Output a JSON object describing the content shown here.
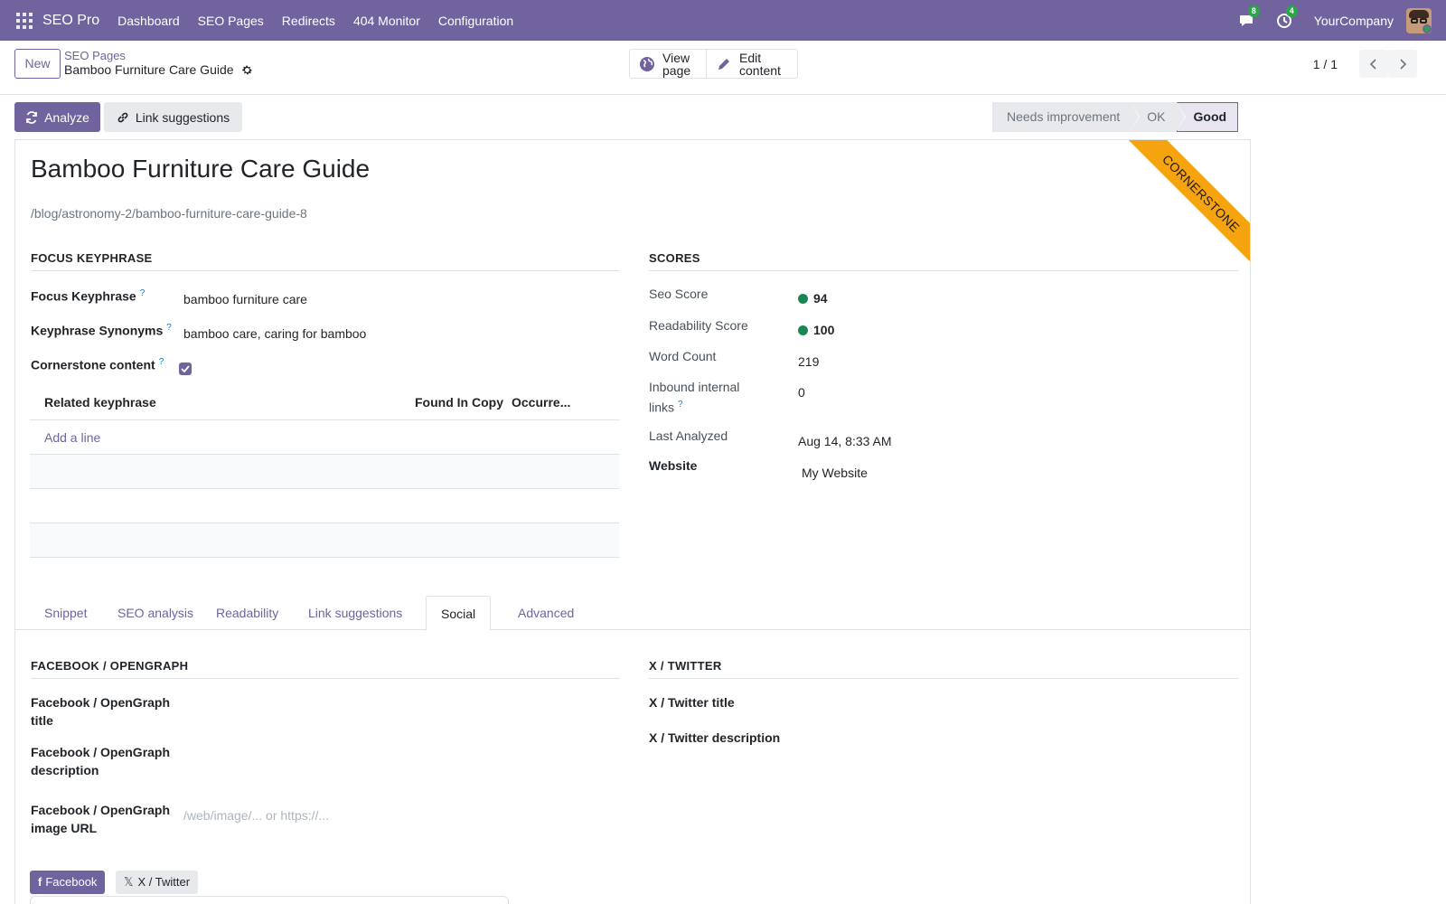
{
  "navbar": {
    "app_name": "SEO Pro",
    "menu": [
      "Dashboard",
      "SEO Pages",
      "Redirects",
      "404 Monitor",
      "Configuration"
    ],
    "messages_count": "8",
    "activities_count": "4",
    "company": "YourCompany",
    "accent_color": "#71639e"
  },
  "control_panel": {
    "new_label": "New",
    "breadcrumb_parent": "SEO Pages",
    "breadcrumb_current": "Bamboo Furniture Care Guide",
    "view_page_label": "View page",
    "edit_content_label": "Edit content",
    "pager": "1 / 1"
  },
  "header": {
    "analyze_label": "Analyze",
    "link_suggestions_label": "Link suggestions",
    "stages": [
      "Needs improvement",
      "OK",
      "Good"
    ],
    "active_stage": "Good"
  },
  "record": {
    "title": "Bamboo Furniture Care Guide",
    "url": "/blog/astronomy-2/bamboo-furniture-care-guide-8",
    "ribbon": "CORNERSTONE"
  },
  "focus": {
    "section_title": "FOCUS KEYPHRASE",
    "keyphrase_label": "Focus Keyphrase",
    "keyphrase_value": "bamboo furniture care",
    "synonyms_label": "Keyphrase Synonyms",
    "synonyms_value": "bamboo care, caring for bamboo",
    "cornerstone_label": "Cornerstone content",
    "cornerstone_checked": true,
    "help_mark": "?",
    "table_headers": [
      "Related keyphrase",
      "Found In Copy",
      "Occurre..."
    ],
    "add_line": "Add a line"
  },
  "scores": {
    "section_title": "SCORES",
    "seo_score_label": "Seo Score",
    "seo_score_value": "94",
    "readability_label": "Readability Score",
    "readability_value": "100",
    "word_count_label": "Word Count",
    "word_count_value": "219",
    "inbound_label_1": "Inbound internal",
    "inbound_label_2": "links",
    "inbound_value": "0",
    "last_analyzed_label": "Last Analyzed",
    "last_analyzed_value": "Aug 14, 8:33 AM",
    "website_label": "Website",
    "website_value": "My Website",
    "good_color": "#198754"
  },
  "tabs": [
    "Snippet",
    "SEO analysis",
    "Readability",
    "Link suggestions",
    "Social",
    "Advanced"
  ],
  "active_tab": "Social",
  "social": {
    "fb_section": "FACEBOOK / OPENGRAPH",
    "fb_title_label_1": "Facebook / OpenGraph",
    "fb_title_label_2": "title",
    "fb_desc_label_1": "Facebook / OpenGraph",
    "fb_desc_label_2": "description",
    "fb_image_label_1": "Facebook / OpenGraph",
    "fb_image_label_2": "image URL",
    "fb_image_placeholder": "/web/image/... or https://...",
    "x_section": "X / TWITTER",
    "x_title_label": "X / Twitter title",
    "x_desc_label": "X / Twitter description",
    "preview_fb_label": "Facebook",
    "preview_x_label": "X / Twitter"
  }
}
